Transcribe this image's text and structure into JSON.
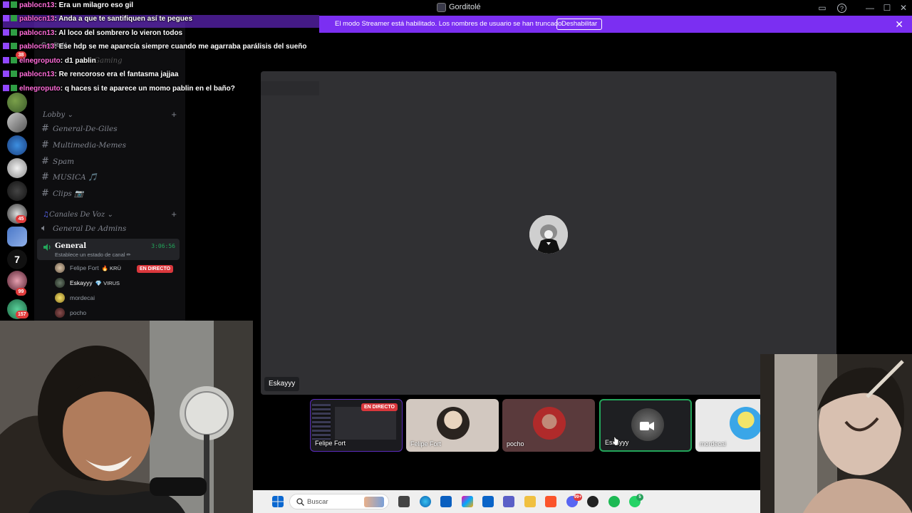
{
  "window": {
    "title": "Gorditolé",
    "controls": {
      "minimize": "—",
      "maximize": "☐",
      "close": "✕"
    }
  },
  "streamer_banner": {
    "text": "El modo Streamer está habilitado. Los nombres de usuario se han truncado.",
    "button": "Deshabilitar",
    "close": "✕"
  },
  "server_list": {
    "badges": [
      "38",
      "45",
      "99",
      "157"
    ]
  },
  "channels": {
    "server_name": "Gorditolé",
    "faded_item": "Gaming",
    "categories": [
      {
        "label": "Lobby",
        "plus": "+"
      },
      {
        "label": "Canales De Voz",
        "plus": "+"
      }
    ],
    "text_channels": [
      "General-De-Giles",
      "Multimedia-Memes",
      "Spam",
      "MUSICA 🎵",
      "Clips 📷"
    ],
    "voice_channels": [
      "General De Admins"
    ],
    "active_voice": {
      "name": "General",
      "status": "Establece un estado de canal ✏",
      "timer": "3:06:56"
    },
    "voice_users": [
      {
        "name": "Felipe Fort",
        "tag": "🔥 KRÜ",
        "live": "EN DIRECTO"
      },
      {
        "name": "Eskayyy",
        "tag": "💎 VIRUS"
      },
      {
        "name": "mordecai",
        "tag": ""
      },
      {
        "name": "pocho",
        "tag": ""
      }
    ]
  },
  "stage": {
    "speaker_name": "Eskayyy"
  },
  "tiles": [
    {
      "label": "Felipe Fort",
      "live": "EN DIRECTO"
    },
    {
      "label": "Felipe Fort"
    },
    {
      "label": "pocho"
    },
    {
      "label": "Eskayyy"
    },
    {
      "label": "mordecai"
    }
  ],
  "chat": [
    {
      "user": "pablocn13",
      "message": ": Era un milagro eso gil",
      "color": "#ff6bd8"
    },
    {
      "user": "pablocn13",
      "message": ": Anda a que te santifiquen así te pegues",
      "color": "#ff6bd8"
    },
    {
      "user": "pablocn13",
      "message": ": Al loco del sombrero lo vieron todos",
      "color": "#ff6bd8"
    },
    {
      "user": "pablocn13",
      "message": ": Ese hdp se me aparecía siempre cuando me agarraba parálisis del sueño",
      "color": "#ff6bd8"
    },
    {
      "user": "elnegroputo",
      "message": ": d1 pablin",
      "color": "#ff6bd8"
    },
    {
      "user": "pablocn13",
      "message": ": Re rencoroso era el fantasma jajjaa",
      "color": "#ff6bd8"
    },
    {
      "user": "elnegroputo",
      "message": ": q haces si te aparece un momo pablin en el baño?",
      "color": "#ff6bd8"
    }
  ],
  "taskbar": {
    "search_placeholder": "Buscar",
    "badges": [
      "99+",
      "5"
    ]
  },
  "colors": {
    "banner": "#7b2ff2",
    "live": "#da373c",
    "voice_green": "#23a55a",
    "chat_username": "#ff6bd8"
  }
}
